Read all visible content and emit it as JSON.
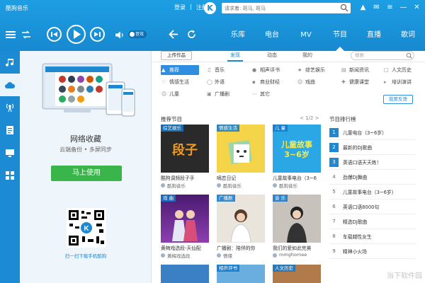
{
  "app": {
    "title": "酷狗音乐",
    "login": "登录",
    "register": "注册",
    "logo": "K"
  },
  "search": {
    "placeholder": "请求着: 斑马, 斑马"
  },
  "window_controls": [
    "shirt-icon",
    "mail-icon",
    "menu-icon",
    "minimize-icon",
    "close-icon"
  ],
  "player": {
    "volume_toggle": "音效"
  },
  "nav": {
    "tabs": [
      "乐库",
      "电台",
      "MV",
      "节目",
      "直播",
      "歌词"
    ],
    "active": "节目"
  },
  "promo": {
    "title": "网络收藏",
    "subtitle": "云端备份 • 多屏同步",
    "button": "马上使用",
    "qr_caption": "扫一扫下载手机酷狗"
  },
  "content": {
    "upload_button": "上传作品",
    "subtabs": [
      "发现",
      "动态",
      "我的"
    ],
    "active_subtab": "发现",
    "search_placeholder": "搜索",
    "categories": [
      {
        "label": "推荐",
        "icon": "thumb-icon"
      },
      {
        "label": "音乐",
        "icon": "note-icon"
      },
      {
        "label": "相声评书",
        "icon": "mic-icon"
      },
      {
        "label": "综艺娱乐",
        "icon": "star-icon"
      },
      {
        "label": "新闻资讯",
        "icon": "news-icon"
      },
      {
        "label": "人文历史",
        "icon": "book-icon"
      },
      {
        "label": "情感生活",
        "icon": "heart-icon"
      },
      {
        "label": "外语",
        "icon": "globe-icon"
      },
      {
        "label": "商业财经",
        "icon": "chart-icon"
      },
      {
        "label": "戏曲",
        "icon": "mask-icon"
      },
      {
        "label": "健康课堂",
        "icon": "health-icon"
      },
      {
        "label": "培训演讲",
        "icon": "speech-icon"
      },
      {
        "label": "儿童",
        "icon": "child-icon"
      },
      {
        "label": "广播剧",
        "icon": "radio-icon"
      },
      {
        "label": "其它",
        "icon": "more-icon"
      }
    ],
    "feedback": "我要反馈",
    "recommend_title": "推荐节目",
    "pager": "< 1/2 >",
    "programs": [
      {
        "tag": "综艺娱乐",
        "title": "酷狗调频段子手",
        "author": "酷狗音乐",
        "art": "段子",
        "bg": "#2a2a2a",
        "fg": "#f29a1f"
      },
      {
        "tag": "情感生活",
        "title": "嘀恋日记",
        "author": "酷狗音乐",
        "art": "",
        "bg": "#f4d54a",
        "fg": "#333"
      },
      {
        "tag": "儿 童",
        "title": "儿童故事电台（3~6",
        "author": "酷狗音乐",
        "art": "儿童故事 3~6岁",
        "bg": "#2ba7e6",
        "fg": "#ffeb3b"
      },
      {
        "tag": "戏 曲",
        "title": "黄梅戏选段-天仙配",
        "author": "黄梅戏选段",
        "art": "",
        "bg": "#6a1f8c",
        "fg": "#fff"
      },
      {
        "tag": "广播剧",
        "title": "广播剧：陪伴的你",
        "author": "情缘",
        "art": "",
        "bg": "#e9e4dc",
        "fg": "#333"
      },
      {
        "tag": "音 乐",
        "title": "我们的爱如此完美",
        "author": "mmghomee",
        "art": "",
        "bg": "#c7c2bb",
        "fg": "#333"
      }
    ],
    "bottom_tags": [
      "",
      "相声评书",
      "人文历史"
    ],
    "rank_title": "节目排行榜",
    "ranks": [
      "儿童电台（3~6岁）",
      "最新的DJ歌曲",
      "英语口语天天练！",
      "劲爆DJ舞曲",
      "儿童故事电台（3~6岁）",
      "英语口语8000句",
      "精选DJ歌曲",
      "车载越性女生",
      "精神小火场"
    ],
    "watermark": "当下软件园"
  }
}
